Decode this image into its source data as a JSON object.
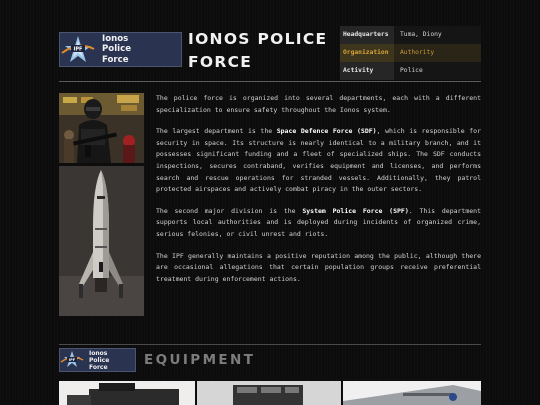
{
  "logo": {
    "badge": "IPF",
    "lines": [
      "Ionos",
      "Police",
      "Force"
    ]
  },
  "page_title": "IONOS POLICE FORCE",
  "infobox": [
    {
      "key": "Headquarters",
      "value": "Tuma, Diony"
    },
    {
      "key": "Organization",
      "value": "Authority"
    },
    {
      "key": "Activity",
      "value": "Police"
    }
  ],
  "paragraphs": {
    "p1": "The police force is organized into several departments, each with a different specialization to ensure safety throughout the Ionos system.",
    "p2_a": "The largest department is the ",
    "p2_b": "Space Defence Force (SDF)",
    "p2_c": ", which is responsible for security in space. Its structure is nearly identical to a military branch, and it possesses significant funding and a fleet of specialized ships. The SDF conducts inspections, secures contraband, verifies equipment and licenses, and performs search and rescue operations for stranded vessels. Additionally, they patrol protected airspaces and actively combat piracy in the outer sectors.",
    "p3_a": "The second major division is the ",
    "p3_b": "System Police Force (SPF)",
    "p3_c": ". This department supports local authorities and is deployed during incidents of organized crime, serious felonies, or civil unrest and riots.",
    "p4": "The IPF generally maintains a positive reputation among the public, although there are occasional allegations that certain population groups receive preferential treatment during enforcement actions."
  },
  "equipment": {
    "title": "EQUIPMENT"
  },
  "colors": {
    "accent": "#d9a33a",
    "logo_bg": "#2a3450",
    "star": "#9cc6e8"
  }
}
